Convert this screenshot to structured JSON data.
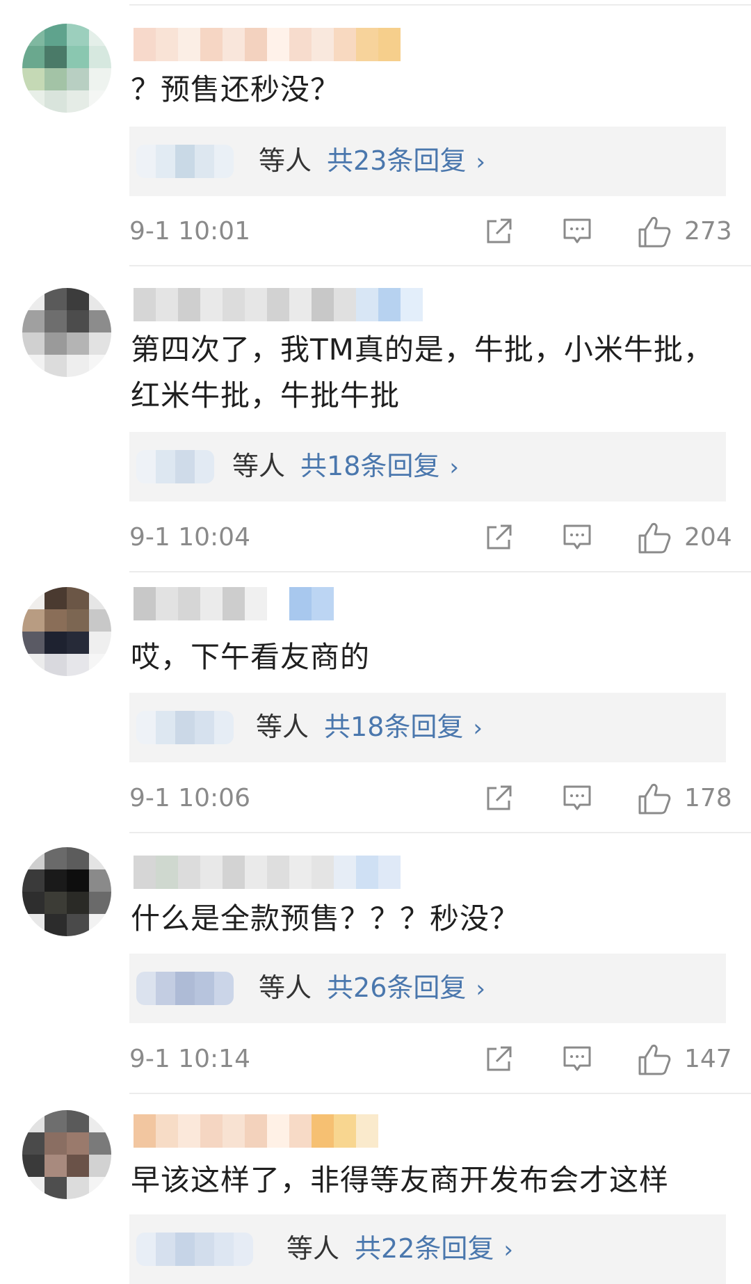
{
  "comments": [
    {
      "text": "？预售还秒没？",
      "reply_suffix": "等人",
      "reply_count": "共23条回复",
      "arrow": "›",
      "time": "9-1 10:01",
      "likes": "273"
    },
    {
      "text": "第四次了，我TM真的是，牛批，小米牛批，红米牛批，牛批牛批",
      "reply_suffix": "等人",
      "reply_count": "共18条回复",
      "arrow": "›",
      "time": "9-1 10:04",
      "likes": "204"
    },
    {
      "text": "哎，下午看友商的",
      "reply_suffix": "等人",
      "reply_count": "共18条回复",
      "arrow": "›",
      "time": "9-1 10:06",
      "likes": "178"
    },
    {
      "text": "什么是全款预售？？？秒没？",
      "reply_suffix": "等人",
      "reply_count": "共26条回复",
      "arrow": "›",
      "time": "9-1 10:14",
      "likes": "147"
    },
    {
      "text": "早该这样了，非得等友商开发布会才这样",
      "reply_suffix": "等人",
      "reply_count": "共22条回复",
      "arrow": "›"
    }
  ],
  "colors": {
    "link": "#4a77ad",
    "meta": "#8a8a8a",
    "reply_bg": "#f3f3f3",
    "divider": "#ececec"
  },
  "icons": {
    "share": "share-icon",
    "comment": "comment-icon",
    "like": "thumbs-up-icon"
  }
}
